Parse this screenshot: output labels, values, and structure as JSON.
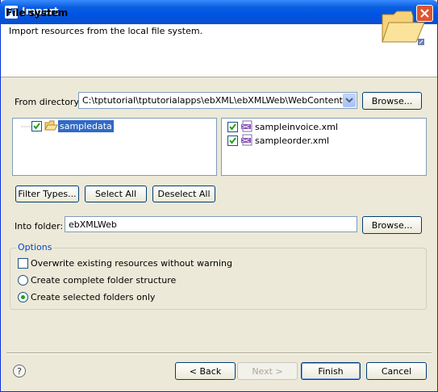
{
  "window": {
    "title": "Import"
  },
  "banner": {
    "title": "File system",
    "description": "Import resources from the local file system."
  },
  "from_directory": {
    "label": "From directory:",
    "value": "C:\\tptutorial\\tptutorialapps\\ebXML\\ebXMLWeb\\WebContent\\samp",
    "browse_label": "Browse..."
  },
  "folder_tree": [
    {
      "label": "sampledata",
      "checked": true,
      "selected": true
    }
  ],
  "file_list": [
    {
      "label": "sampleinvoice.xml",
      "checked": true
    },
    {
      "label": "sampleorder.xml",
      "checked": true
    }
  ],
  "selection_buttons": {
    "filter": "Filter Types...",
    "select_all": "Select All",
    "deselect_all": "Deselect All"
  },
  "into_folder": {
    "label": "Into folder:",
    "value": "ebXMLWeb",
    "browse_label": "Browse..."
  },
  "options": {
    "title": "Options",
    "overwrite": {
      "label": "Overwrite existing resources without warning",
      "checked": false
    },
    "radios": [
      {
        "label": "Create complete folder structure",
        "selected": false
      },
      {
        "label": "Create selected folders only",
        "selected": true
      }
    ]
  },
  "footer": {
    "help_glyph": "?",
    "back": "< Back",
    "next": "Next >",
    "finish": "Finish",
    "cancel": "Cancel"
  },
  "colors": {
    "title_bar": "#0054e3",
    "selection": "#316ac5",
    "check": "#21a121",
    "options_title": "#0046d5"
  }
}
